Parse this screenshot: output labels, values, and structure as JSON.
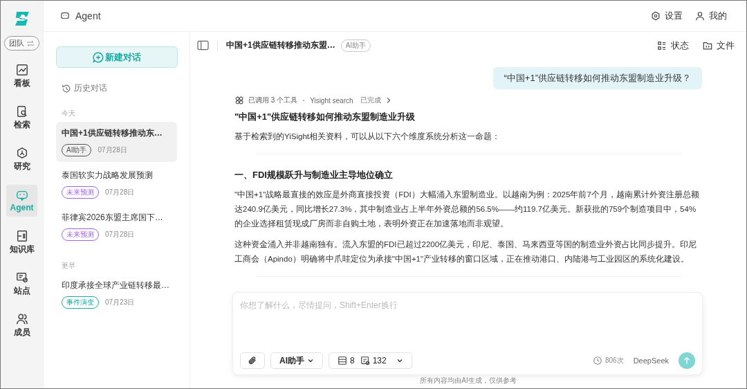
{
  "rail": {
    "team_switch": "团队",
    "items": [
      {
        "label": "看板",
        "selected": false
      },
      {
        "label": "检索",
        "selected": false
      },
      {
        "label": "研究",
        "selected": false
      },
      {
        "label": "Agent",
        "selected": true
      },
      {
        "label": "知识库",
        "selected": false
      },
      {
        "label": "站点",
        "selected": false
      },
      {
        "label": "成员",
        "selected": false
      }
    ]
  },
  "header": {
    "title": "Agent",
    "actions": [
      "设置",
      "我的"
    ]
  },
  "sidebar": {
    "new_chat": "新建对话",
    "history_label": "历史对话",
    "groups": [
      {
        "label": "今天",
        "items": [
          {
            "title": "中国+1供应链转移推动东…",
            "tag": {
              "label": "AI助手",
              "color": "#555555"
            },
            "date": "07月28日",
            "selected": true
          },
          {
            "title": "泰国软实力战略发展预测",
            "tag": {
              "label": "未来预测",
              "color": "#a066e0"
            },
            "date": "07月28日",
            "selected": false
          },
          {
            "title": "菲律宾2026东盟主席国下…",
            "tag": {
              "label": "未来预测",
              "color": "#a066e0"
            },
            "date": "07月28日",
            "selected": false
          }
        ]
      },
      {
        "label": "更早",
        "items": [
          {
            "title": "印度承接全球产业链转移最…",
            "tag": {
              "label": "事件演变",
              "color": "#1fa8a0"
            },
            "date": "07月23日",
            "selected": false
          }
        ]
      }
    ]
  },
  "chat": {
    "title": "中国+1供应链转移推动东盟…",
    "tag": "AI助手",
    "actions": [
      "状态",
      "文件"
    ],
    "user_message": "“中国+1”供应链转移如何推动东盟制造业升级？",
    "tool_call": {
      "summary": "已调用 3 个工具",
      "source": "Yisight search",
      "status": "已完成"
    },
    "answer_title": "\"中国+1\"供应链转移如何推动东盟制造业升级",
    "intro": "基于检索到的YiSight相关资料，可以从以下六个维度系统分析这一命题：",
    "sections": [
      {
        "heading": "一、FDI规模跃升与制造业主导地位确立",
        "paragraphs": [
          "\"中国+1\"战略最直接的效应是外商直接投资（FDI）大幅涌入东盟制造业。以越南为例：2025年前7个月，越南累计外资注册总额达240.9亿美元，同比增长27.3%，其中制造业占上半年外资总额的56.5%——约119.7亿美元。新获批的759个制造项目中，54%的企业选择租赁现成厂房而非自购土地，表明外资正在加速落地而非观望。",
          "这种资金涌入并非越南独有。流入东盟的FDI已超过2200亿美元，印尼、泰国、马来西亚等国的制造业外资占比同步提升。印尼工商会（Apindo）明确将中爪哇定位为承接\"中国+1\"产业转移的窗口区域，正在推动港口、内陆港与工业园区的系统化建设。"
        ]
      }
    ]
  },
  "composer": {
    "placeholder": "你想了解什么，尽情提问，Shift+Enter换行",
    "mode": "AI助手",
    "counts": [
      "8",
      "132"
    ],
    "usage": "806次",
    "model": "DeepSeek"
  },
  "footer": "所有内容均由AI生成，仅供参考"
}
